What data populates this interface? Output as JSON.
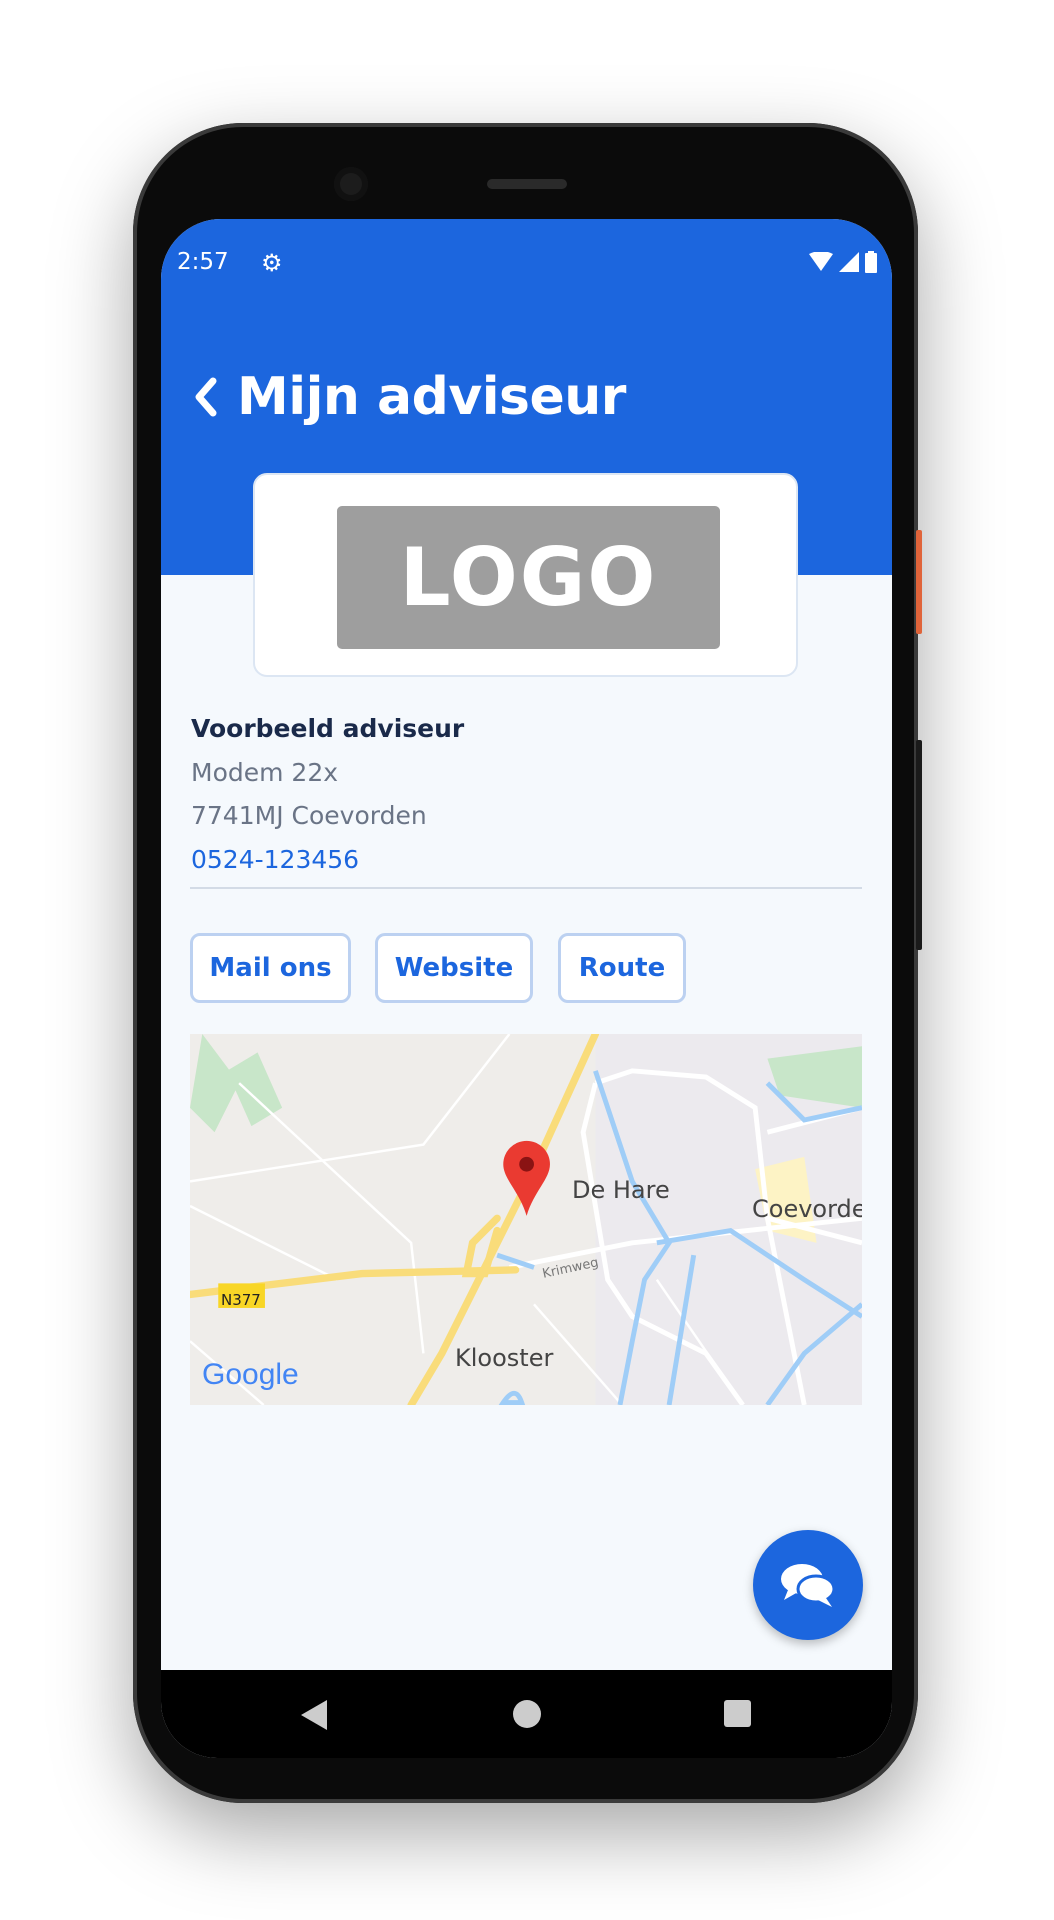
{
  "status_bar": {
    "time": "2:57",
    "icons": [
      "gear-icon",
      "wifi-icon",
      "signal-icon",
      "battery-icon"
    ]
  },
  "header": {
    "title": "Mijn adviseur",
    "back_icon": "chevron-left-icon"
  },
  "logo": {
    "text": "LOGO"
  },
  "advisor": {
    "name": "Voorbeeld adviseur",
    "street": "Modem 22x",
    "city": "7741MJ Coevorden",
    "phone": "0524-123456"
  },
  "actions": {
    "mail": "Mail ons",
    "website": "Website",
    "route": "Route"
  },
  "map": {
    "labels": {
      "de_hare": "De Hare",
      "coevorden": "Coevorden",
      "krimweg": "Krimweg",
      "road": "N377",
      "klooster": "Klooster"
    },
    "attribution": "Google"
  },
  "fab": {
    "icon": "chat-icon"
  },
  "colors": {
    "brand": "#1c66de",
    "background": "#f5f9fd",
    "text_dark": "#1a2a4a",
    "text_muted": "#6a7486"
  }
}
